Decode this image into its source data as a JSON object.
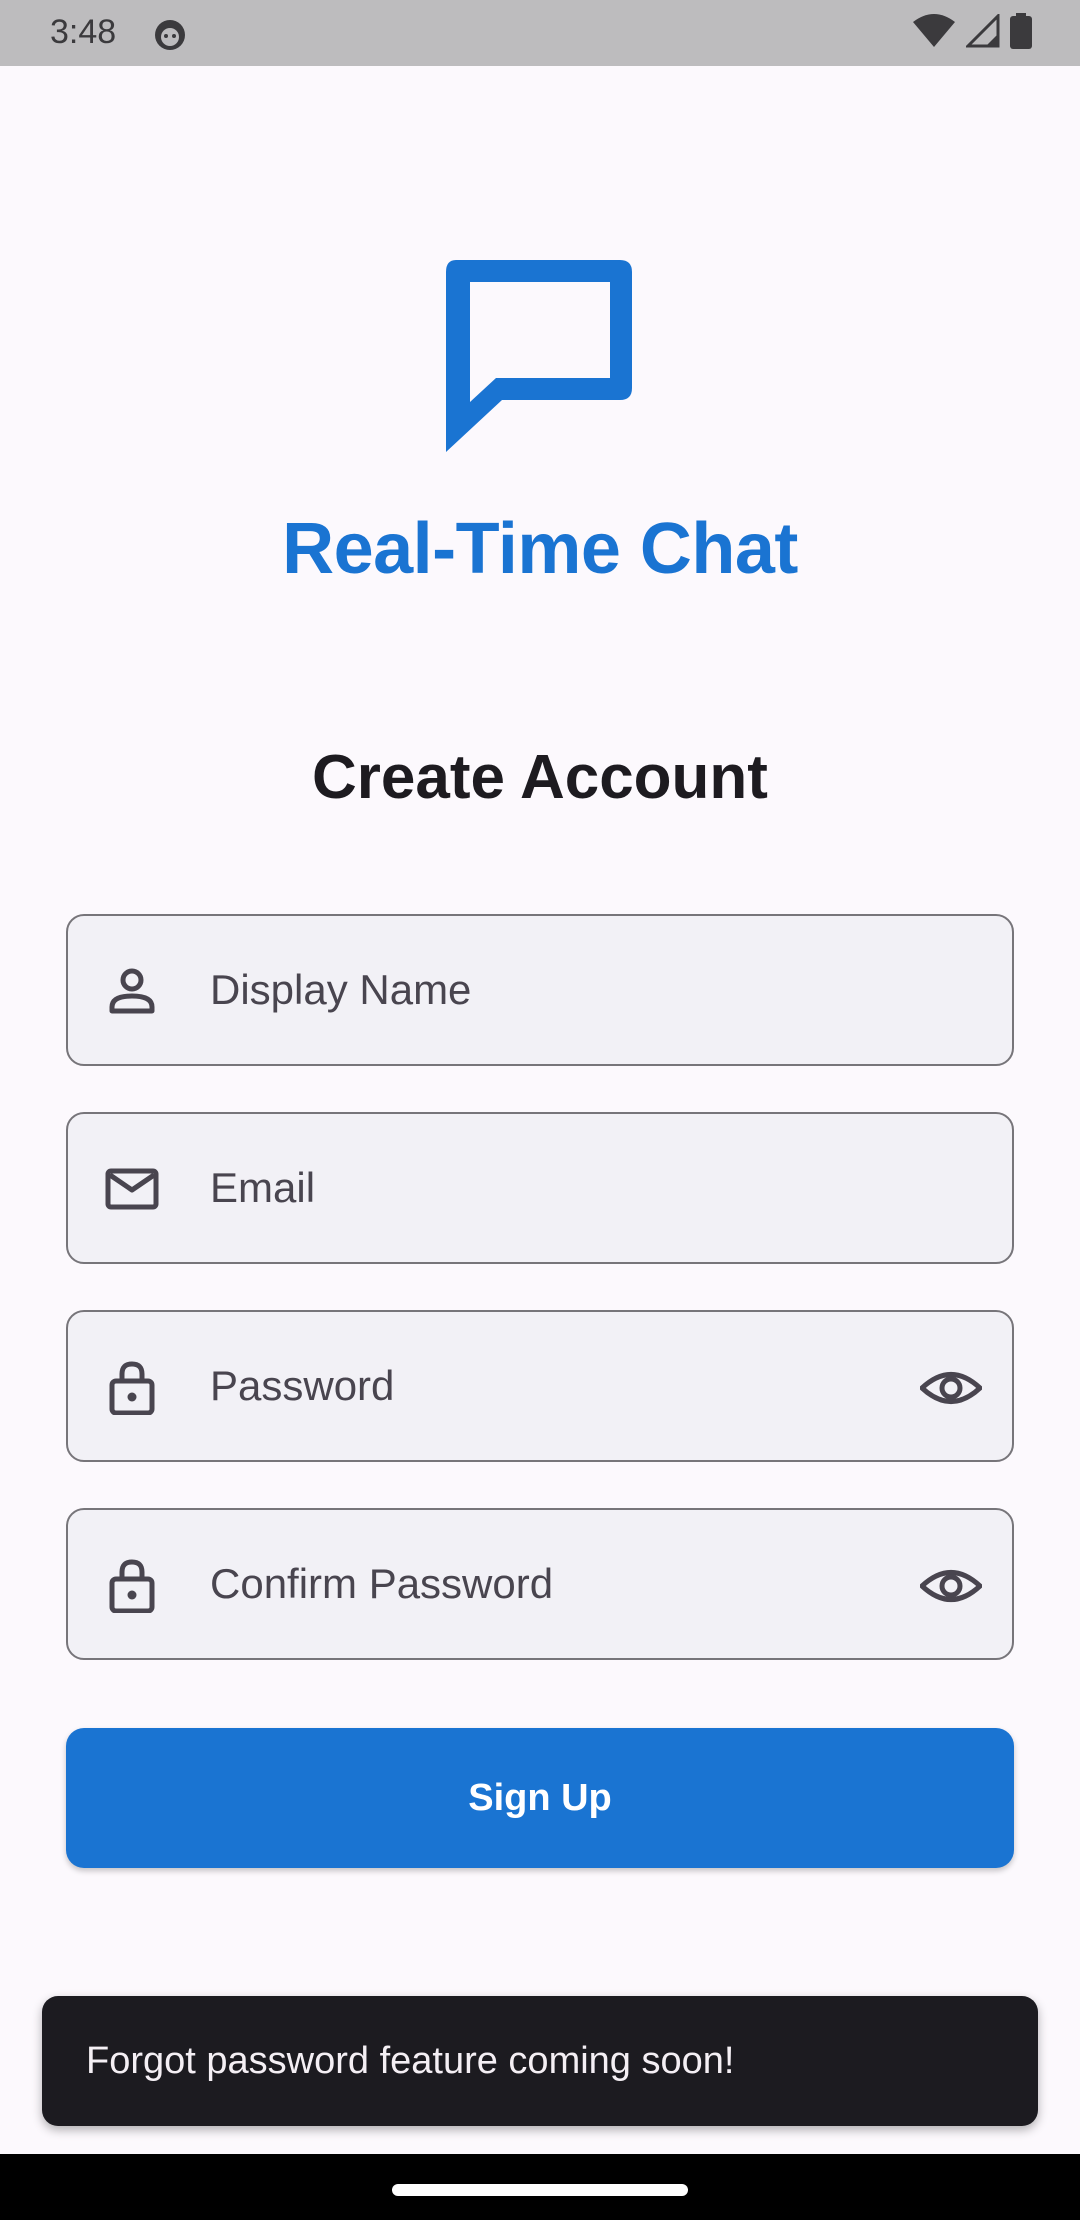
{
  "status_bar": {
    "time": "3:48"
  },
  "app": {
    "title": "Real-Time Chat",
    "logo_icon": "chat-bubble-outline-icon",
    "brand_color": "#1a74d2"
  },
  "page": {
    "title": "Create Account"
  },
  "form": {
    "display_name": {
      "placeholder": "Display Name",
      "icon": "person-icon"
    },
    "email": {
      "placeholder": "Email",
      "icon": "mail-icon"
    },
    "password": {
      "placeholder": "Password",
      "icon": "lock-icon",
      "toggle_icon": "eye-icon"
    },
    "confirm_password": {
      "placeholder": "Confirm Password",
      "icon": "lock-icon",
      "toggle_icon": "eye-icon"
    },
    "submit_label": "Sign Up"
  },
  "snackbar": {
    "message": "Forgot password feature coming soon!"
  }
}
